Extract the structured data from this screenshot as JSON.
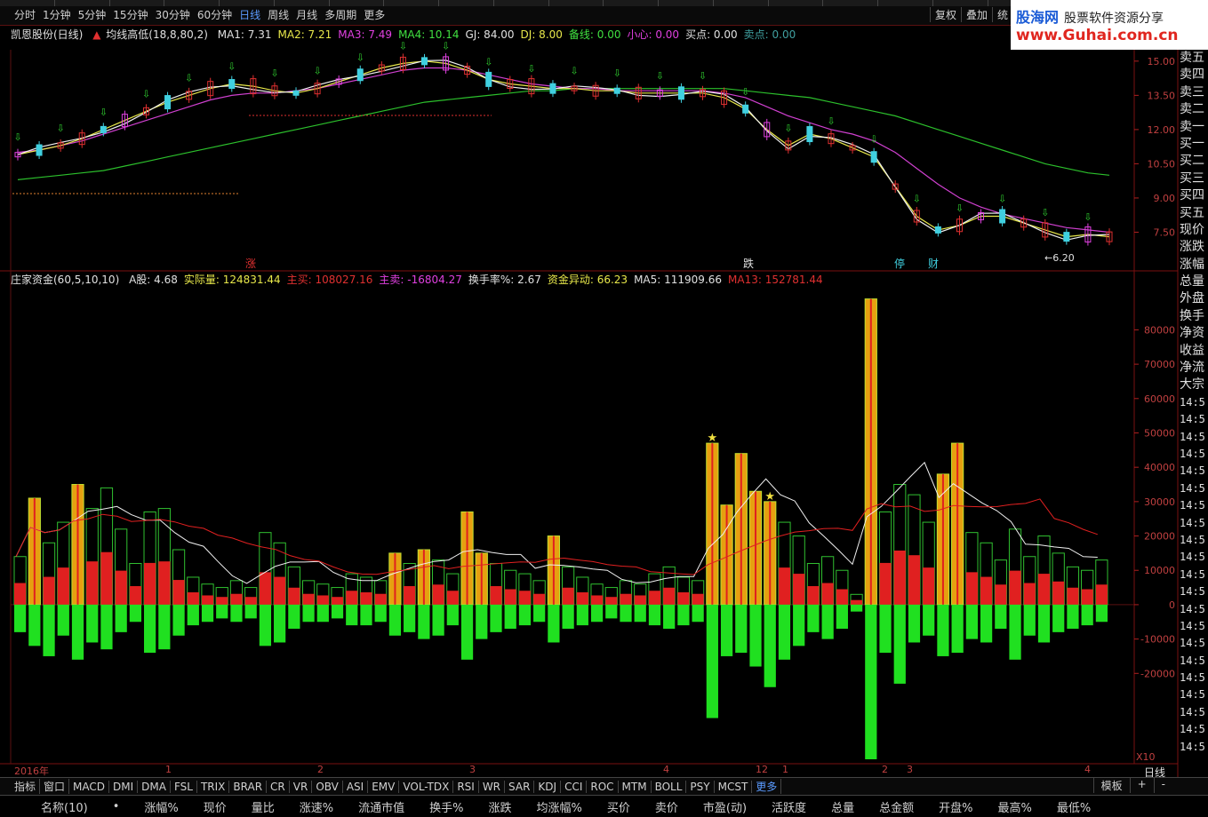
{
  "top_nav": {
    "periods": [
      "分时",
      "1分钟",
      "5分钟",
      "15分钟",
      "30分钟",
      "60分钟",
      "日线",
      "周线",
      "月线",
      "多周期",
      "更多"
    ],
    "active_period": "日线",
    "right_buttons": [
      "复权",
      "叠加",
      "统"
    ]
  },
  "logo": {
    "brand": "股海网",
    "slogan": "股票软件资源分享",
    "url": "www.Guhai.com.cn"
  },
  "main_chart": {
    "title": "凯恩股份(日线)",
    "indicator": "均线高低(18,8,80,2)",
    "fields": [
      {
        "label": "MA1: 7.31",
        "color": "#e0e0e0"
      },
      {
        "label": "MA2: 7.21",
        "color": "#e8e84a"
      },
      {
        "label": "MA3: 7.49",
        "color": "#e040e0"
      },
      {
        "label": "MA4: 10.14",
        "color": "#40e040"
      },
      {
        "label": "GJ: 84.00",
        "color": "#e0e0e0"
      },
      {
        "label": "DJ: 8.00",
        "color": "#e8e84a"
      },
      {
        "label": "备线: 0.00",
        "color": "#40e040"
      },
      {
        "label": "小心: 0.00",
        "color": "#e040e0"
      },
      {
        "label": "买点: 0.00",
        "color": "#e0e0e0"
      },
      {
        "label": "卖点: 0.00",
        "color": "#40a0a0"
      }
    ],
    "y_ticks": [
      "15.00",
      "13.50",
      "12.00",
      "10.50",
      "9.00",
      "7.50"
    ],
    "low_marker": "6.20",
    "labels": [
      "涨",
      "跌",
      "停",
      "财"
    ]
  },
  "sub_chart": {
    "indicator": "庄家资金(60,5,10,10)",
    "fields": [
      {
        "label": "A股: 4.68",
        "color": "#e0e0e0"
      },
      {
        "label": "实际量: 124831.44",
        "color": "#e8e84a"
      },
      {
        "label": "主买: 108027.16",
        "color": "#e03030"
      },
      {
        "label": "主卖: -16804.27",
        "color": "#e040e0"
      },
      {
        "label": "换手率%: 2.67",
        "color": "#e0e0e0"
      },
      {
        "label": "资金异动: 66.23",
        "color": "#e8e84a"
      },
      {
        "label": "MA5: 111909.66",
        "color": "#e0e0e0"
      },
      {
        "label": "MA13: 152781.44",
        "color": "#e03030"
      }
    ],
    "y_ticks": [
      "80000",
      "70000",
      "60000",
      "50000",
      "40000",
      "30000",
      "20000",
      "10000",
      "0",
      "-10000",
      "-20000"
    ]
  },
  "right_panel": [
    "卖五",
    "卖四",
    "卖三",
    "卖二",
    "卖一",
    "买一",
    "买二",
    "买三",
    "买四",
    "买五",
    "现价",
    "涨跌",
    "涨幅",
    "总量",
    "外盘",
    "换手",
    "净资",
    "收益",
    "净流",
    "大宗"
  ],
  "time_list": "14:5",
  "date_axis": {
    "year": "2016年",
    "months": [
      "1",
      "2",
      "3",
      "4",
      "12",
      "1",
      "2",
      "3",
      "4"
    ],
    "x10": "X10",
    "period": "日线"
  },
  "bottom_tabs": [
    "指标",
    "窗口",
    "MACD",
    "DMI",
    "DMA",
    "FSL",
    "TRIX",
    "BRAR",
    "CR",
    "VR",
    "OBV",
    "ASI",
    "EMV",
    "VOL-TDX",
    "RSI",
    "WR",
    "SAR",
    "KDJ",
    "CCI",
    "ROC",
    "MTM",
    "BOLL",
    "PSY",
    "MCST",
    "更多"
  ],
  "bottom_right": [
    "模板",
    "+",
    "-"
  ],
  "columns": [
    "名称(10)",
    "•",
    "涨幅%",
    "现价",
    "量比",
    "涨速%",
    "流通市值",
    "换手%",
    "涨跌",
    "均涨幅%",
    "买价",
    "卖价",
    "市盈(动)",
    "活跃度",
    "总量",
    "总金额",
    "开盘%",
    "最高%",
    "最低%"
  ],
  "chart_data": {
    "type": "bar",
    "title": "庄家资金(60,5,10,10)",
    "ylim": [
      -45000,
      92000
    ],
    "price_range": [
      6.0,
      15.5
    ],
    "price_ma1": [
      10.9,
      11.1,
      11.3,
      11.6,
      12.0,
      12.4,
      12.8,
      13.2,
      13.5,
      13.8,
      14.0,
      13.9,
      13.7,
      13.6,
      13.8,
      14.1,
      14.4,
      14.7,
      14.9,
      15.0,
      14.9,
      14.6,
      14.2,
      14.0,
      13.9,
      13.8,
      13.8,
      13.7,
      13.7,
      13.6,
      13.6,
      13.6,
      13.6,
      13.4,
      12.9,
      12.0,
      11.3,
      11.8,
      11.6,
      11.2,
      10.8,
      9.5,
      8.2,
      7.6,
      7.8,
      8.2,
      8.2,
      7.9,
      7.6,
      7.3,
      7.4,
      7.3
    ],
    "price_ma3": [
      11.0,
      11.1,
      11.3,
      11.5,
      11.8,
      12.1,
      12.4,
      12.7,
      13.0,
      13.3,
      13.5,
      13.6,
      13.6,
      13.7,
      13.8,
      14.0,
      14.2,
      14.4,
      14.6,
      14.7,
      14.7,
      14.6,
      14.4,
      14.2,
      14.0,
      13.9,
      13.8,
      13.8,
      13.7,
      13.7,
      13.7,
      13.7,
      13.7,
      13.6,
      13.4,
      13.0,
      12.6,
      12.3,
      12.0,
      11.8,
      11.5,
      11.0,
      10.3,
      9.6,
      9.0,
      8.6,
      8.3,
      8.1,
      7.9,
      7.7,
      7.6,
      7.5
    ],
    "price_ma4": [
      9.8,
      9.9,
      10.0,
      10.1,
      10.2,
      10.4,
      10.6,
      10.8,
      11.0,
      11.2,
      11.4,
      11.6,
      11.8,
      12.0,
      12.2,
      12.4,
      12.6,
      12.8,
      13.0,
      13.2,
      13.3,
      13.4,
      13.5,
      13.6,
      13.7,
      13.7,
      13.8,
      13.8,
      13.8,
      13.8,
      13.8,
      13.8,
      13.8,
      13.8,
      13.7,
      13.6,
      13.5,
      13.4,
      13.2,
      13.0,
      12.8,
      12.6,
      12.3,
      12.0,
      11.7,
      11.4,
      11.1,
      10.8,
      10.5,
      10.3,
      10.1,
      10.0
    ],
    "volume": [
      14000,
      31000,
      18000,
      24000,
      35000,
      28000,
      34000,
      22000,
      12000,
      27000,
      28000,
      16000,
      8000,
      6000,
      5000,
      7000,
      5000,
      21000,
      18000,
      11000,
      7000,
      6000,
      5000,
      9000,
      8000,
      7000,
      15000,
      12000,
      16000,
      13000,
      9000,
      27000,
      15000,
      12000,
      10000,
      9000,
      7000,
      20000,
      11000,
      8000,
      6000,
      5000,
      7000,
      6000,
      9000,
      11000,
      8000,
      7000,
      47000,
      29000,
      44000,
      33000,
      30000,
      24000,
      20000,
      12000,
      14000,
      10000,
      3000,
      89000,
      27000,
      35000,
      32000,
      24000,
      38000,
      47000,
      21000,
      18000,
      13000,
      22000,
      14000,
      20000,
      15000,
      11000,
      10000,
      13000
    ],
    "sell": [
      -8000,
      -12000,
      -15000,
      -9000,
      -16000,
      -11000,
      -13000,
      -8000,
      -5000,
      -14000,
      -13000,
      -9000,
      -6000,
      -5000,
      -4000,
      -5000,
      -4000,
      -12000,
      -11000,
      -7000,
      -5000,
      -5000,
      -4000,
      -6000,
      -6000,
      -5000,
      -9000,
      -8000,
      -10000,
      -9000,
      -6000,
      -16000,
      -10000,
      -8000,
      -7000,
      -6000,
      -5000,
      -11000,
      -7000,
      -6000,
      -5000,
      -4000,
      -5000,
      -5000,
      -6000,
      -7000,
      -6000,
      -5000,
      -33000,
      -15000,
      -14000,
      -18000,
      -24000,
      -16000,
      -12000,
      -8000,
      -10000,
      -7000,
      -2000,
      -45000,
      -14000,
      -23000,
      -11000,
      -9000,
      -15000,
      -14000,
      -10000,
      -11000,
      -7000,
      -16000,
      -9000,
      -11000,
      -8000,
      -7000,
      -6000,
      -5000
    ]
  }
}
